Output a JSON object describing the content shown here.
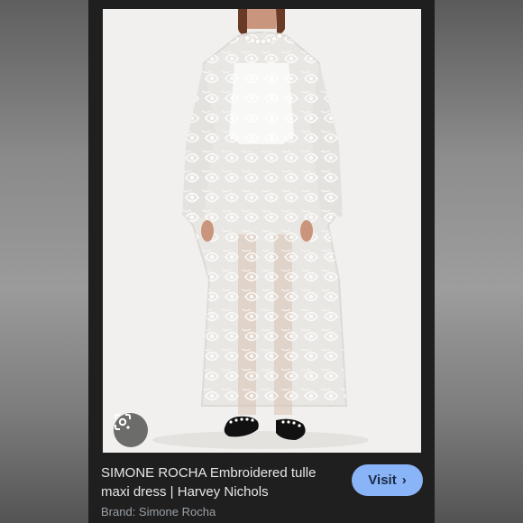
{
  "result": {
    "title": "SIMONE ROCHA Embroidered tulle maxi dress | Harvey Nichols",
    "brand": "Brand: Simone Rocha",
    "visit_label": "Visit",
    "visit_icon": "chevron-right-icon",
    "lens_icon": "google-lens-icon"
  },
  "colors": {
    "card_bg": "#1f1f1f",
    "visit_bg": "#8ab4f8",
    "title_text": "#e6e6e6",
    "brand_text": "#9aa0a6"
  }
}
